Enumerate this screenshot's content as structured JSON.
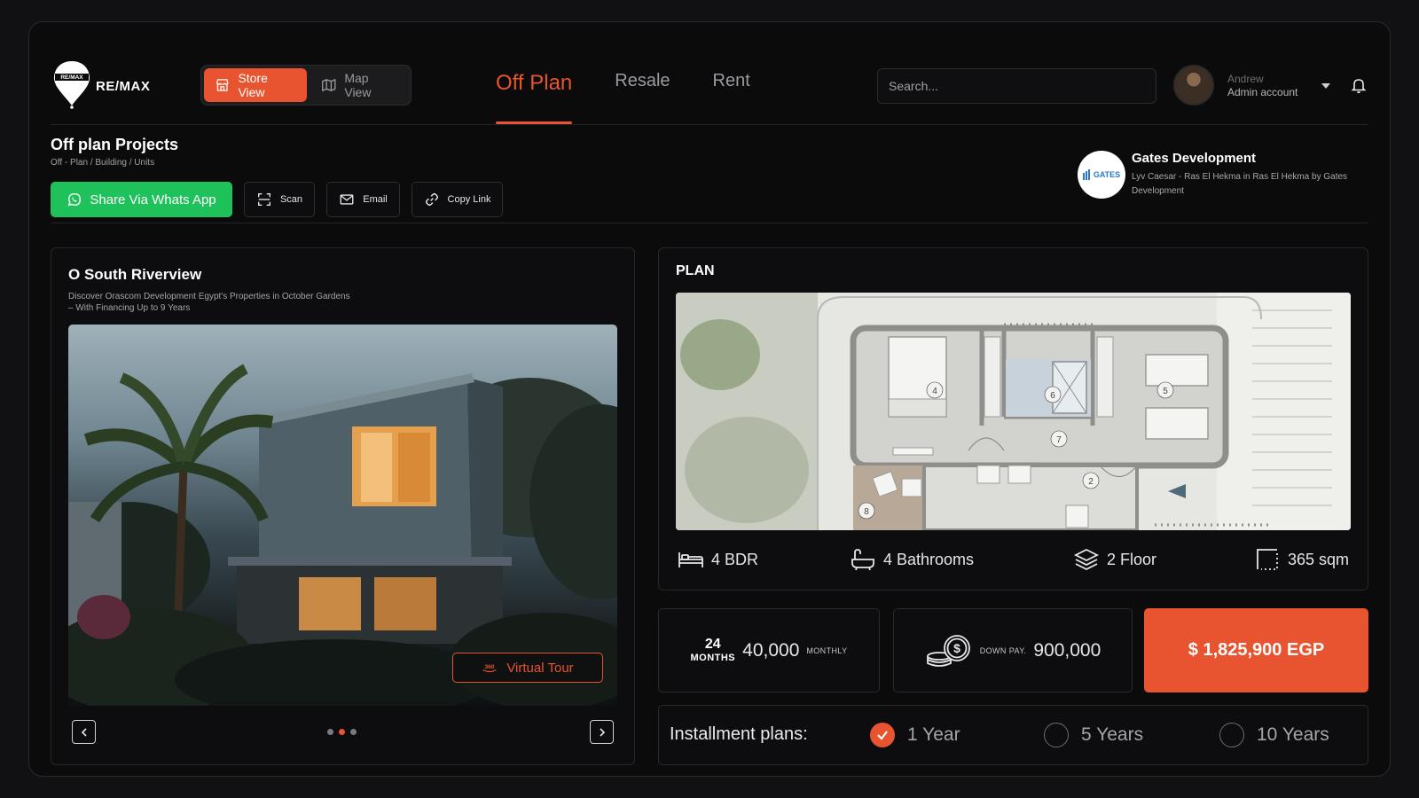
{
  "header": {
    "brand": "RE/MAX",
    "view_switch": {
      "store": "Store View",
      "map": "Map View",
      "active": "store"
    },
    "tabs": [
      {
        "label": "Off Plan",
        "active": true
      },
      {
        "label": "Resale",
        "active": false
      },
      {
        "label": "Rent",
        "active": false
      }
    ],
    "search_placeholder": "Search...",
    "user": {
      "name": "Andrew",
      "role": "Admin account"
    }
  },
  "page": {
    "title": "Off plan Projects",
    "breadcrumb": "Off - Plan / Building / Units"
  },
  "actions": {
    "whatsapp": "Share Via Whats App",
    "scan": "Scan",
    "email": "Email",
    "copy_link": "Copy Link"
  },
  "developer": {
    "name": "Gates Development",
    "logo_text": "GATES",
    "description": "Lyv Caesar - Ras El Hekma in Ras El Hekma by Gates Development"
  },
  "project": {
    "title": "O South Riverview",
    "description": "Discover Orascom Development Egypt's Properties in October Gardens – With Financing Up to 9 Years",
    "virtual_tour": "Virtual Tour",
    "virtual_tour_icon": "360",
    "carousel": {
      "total": 3,
      "active": 2
    }
  },
  "plan": {
    "label": "PLAN",
    "room_markers": [
      "4",
      "6",
      "5",
      "7",
      "2",
      "8"
    ],
    "specs": {
      "bedrooms": "4 BDR",
      "bathrooms": "4 Bathrooms",
      "floors": "2 Floor",
      "area": "365 sqm"
    }
  },
  "pricing": {
    "months_num": "24",
    "months_label": "MONTHS",
    "monthly_amount": "40,000",
    "monthly_label": "MONTHLY",
    "down_label": "DOWN PAY.",
    "down_amount": "900,000",
    "total_price": "$ 1,825,900 EGP"
  },
  "installments": {
    "label": "Installment plans:",
    "options": [
      {
        "label": "1 Year",
        "checked": true
      },
      {
        "label": "5 Years",
        "checked": false
      },
      {
        "label": "10 Years",
        "checked": false
      }
    ]
  },
  "colors": {
    "accent": "#e8542f",
    "whatsapp": "#1fc15a",
    "background": "#0b0b0c"
  }
}
